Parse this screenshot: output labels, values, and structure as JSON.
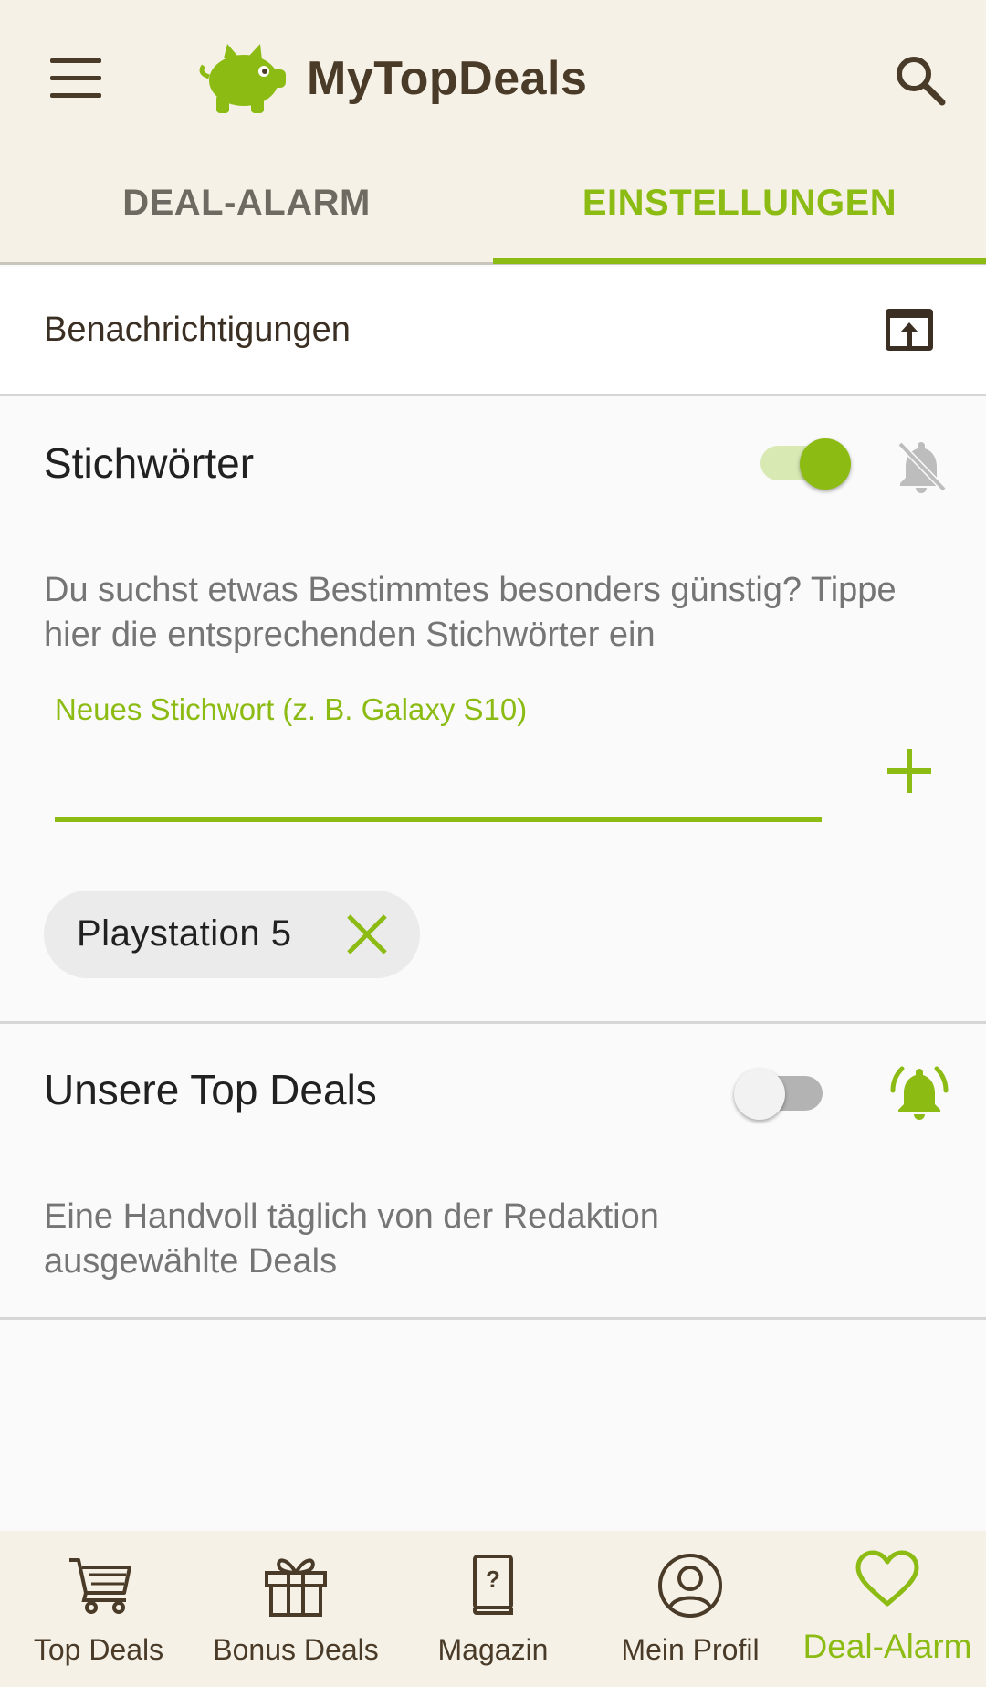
{
  "app": {
    "title": "MyTopDeals",
    "accent_color": "#8cbc14",
    "brand_brown": "#4a3a28",
    "header_bg": "#f5f1e6"
  },
  "header": {
    "menu_icon": "hamburger-menu-icon",
    "logo_icon": "piggy-logo-icon",
    "search_icon": "search-icon"
  },
  "tabs": [
    {
      "label": "DEAL-ALARM",
      "active": false
    },
    {
      "label": "EINSTELLUNGEN",
      "active": true
    }
  ],
  "notifications": {
    "label": "Benachrichtigungen",
    "icon": "open-in-app-icon"
  },
  "keywords_section": {
    "title": "Stichwörter",
    "toggle_on": true,
    "bell_icon": "bell-off-icon",
    "description": "Du suchst etwas Bestimmtes besonders günstig? Tippe hier die entsprechenden Stichwörter ein",
    "input_label": "Neues Stichwort (z. B. Galaxy S10)",
    "input_value": "",
    "add_icon": "plus-icon",
    "chips": [
      {
        "label": "Playstation 5",
        "remove_icon": "close-icon"
      }
    ]
  },
  "top_deals_section": {
    "title": "Unsere Top Deals",
    "toggle_on": false,
    "bell_icon": "bell-ringing-icon",
    "description": "Eine Handvoll täglich von der Redaktion ausgewählte Deals"
  },
  "bottom_nav": [
    {
      "label": "Top Deals",
      "icon": "cart-icon",
      "active": false
    },
    {
      "label": "Bonus Deals",
      "icon": "gift-icon",
      "active": false
    },
    {
      "label": "Magazin",
      "icon": "book-question-icon",
      "active": false
    },
    {
      "label": "Mein Profil",
      "icon": "user-circle-icon",
      "active": false
    },
    {
      "label": "Deal-Alarm",
      "icon": "heart-icon",
      "active": true
    }
  ]
}
